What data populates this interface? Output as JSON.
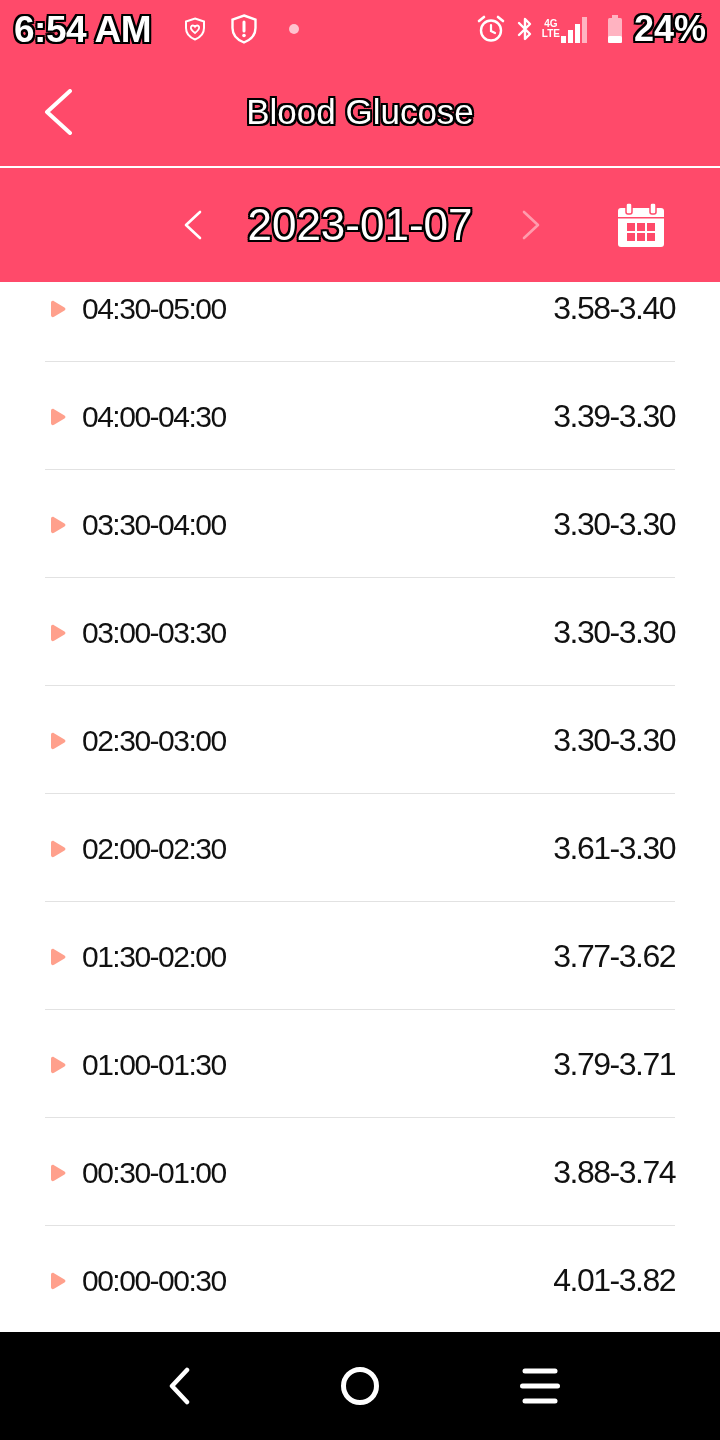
{
  "status_bar": {
    "time": "6:54 AM",
    "network": {
      "generation": "4G",
      "type": "LTE"
    },
    "battery": "24%"
  },
  "header": {
    "title": "Blood Glucose"
  },
  "date_bar": {
    "date": "2023-01-07",
    "prev": {
      "disabled": false
    },
    "next": {
      "disabled": true
    }
  },
  "readings": [
    {
      "time_range": "04:30-05:00",
      "value_range": "3.58-3.40",
      "expanded": false
    },
    {
      "time_range": "04:00-04:30",
      "value_range": "3.39-3.30",
      "expanded": false
    },
    {
      "time_range": "03:30-04:00",
      "value_range": "3.30-3.30",
      "expanded": false
    },
    {
      "time_range": "03:00-03:30",
      "value_range": "3.30-3.30",
      "expanded": false
    },
    {
      "time_range": "02:30-03:00",
      "value_range": "3.30-3.30",
      "expanded": false
    },
    {
      "time_range": "02:00-02:30",
      "value_range": "3.61-3.30",
      "expanded": false
    },
    {
      "time_range": "01:30-02:00",
      "value_range": "3.77-3.62",
      "expanded": false
    },
    {
      "time_range": "01:00-01:30",
      "value_range": "3.79-3.71",
      "expanded": false
    },
    {
      "time_range": "00:30-01:00",
      "value_range": "3.88-3.74",
      "expanded": false
    },
    {
      "time_range": "00:00-00:30",
      "value_range": "4.01-3.82",
      "expanded": false
    }
  ]
}
